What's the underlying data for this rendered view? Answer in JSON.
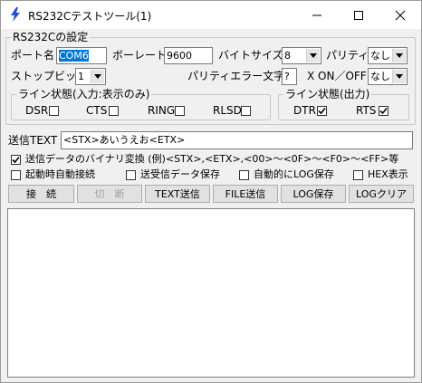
{
  "window": {
    "title": "RS232Cテストツール(1)"
  },
  "settings": {
    "group_title": "RS232Cの設定",
    "port_label": "ポート名",
    "port_value": "COM6",
    "baud_label": "ボーレート",
    "baud_value": "9600",
    "bytesize_label": "バイトサイズ",
    "bytesize_value": "8",
    "parity_label": "パリティ",
    "parity_value": "なし",
    "stopbit_label": "ストップビット",
    "stopbit_value": "1",
    "parity_error_label": "パリティエラー文字",
    "parity_error_value": "?",
    "xonoff_label": "X ON／OFF",
    "xonoff_value": "なし"
  },
  "line_in": {
    "title": "ライン状態(入力:表示のみ)",
    "items": [
      {
        "label": "DSR",
        "checked": false
      },
      {
        "label": "CTS",
        "checked": false
      },
      {
        "label": "RING",
        "checked": false
      },
      {
        "label": "RLSD",
        "checked": false
      }
    ]
  },
  "line_out": {
    "title": "ライン状態(出力)",
    "items": [
      {
        "label": "DTR",
        "checked": true
      },
      {
        "label": "RTS",
        "checked": true
      }
    ]
  },
  "send": {
    "label": "送信TEXT",
    "value": "<STX>あいうえお<ETX>"
  },
  "options": {
    "binary_convert": {
      "label": "送信データのバイナリ変換 (例)<STX>,<ETX>,<00>～<0F>～<F0>～<FF>等",
      "checked": true
    },
    "auto_connect": {
      "label": "起動時自動接続",
      "checked": false
    },
    "save_data": {
      "label": "送受信データ保存",
      "checked": false
    },
    "auto_log": {
      "label": "自動的にLOG保存",
      "checked": false
    },
    "hex_display": {
      "label": "HEX表示",
      "checked": false
    }
  },
  "buttons": {
    "connect": "接　続",
    "disconnect": "切　断",
    "text_send": "TEXT送信",
    "file_send": "FILE送信",
    "log_save": "LOG保存",
    "log_clear": "LOGクリア"
  },
  "icons": {
    "app": "lightning-bolt-icon",
    "minimize": "minimize-icon",
    "maximize": "maximize-icon",
    "close": "close-icon",
    "dropdown": "chevron-down-icon",
    "check": "check-icon"
  },
  "colors": {
    "selection": "#0078d7",
    "app_icon": "#1e4fd8"
  }
}
